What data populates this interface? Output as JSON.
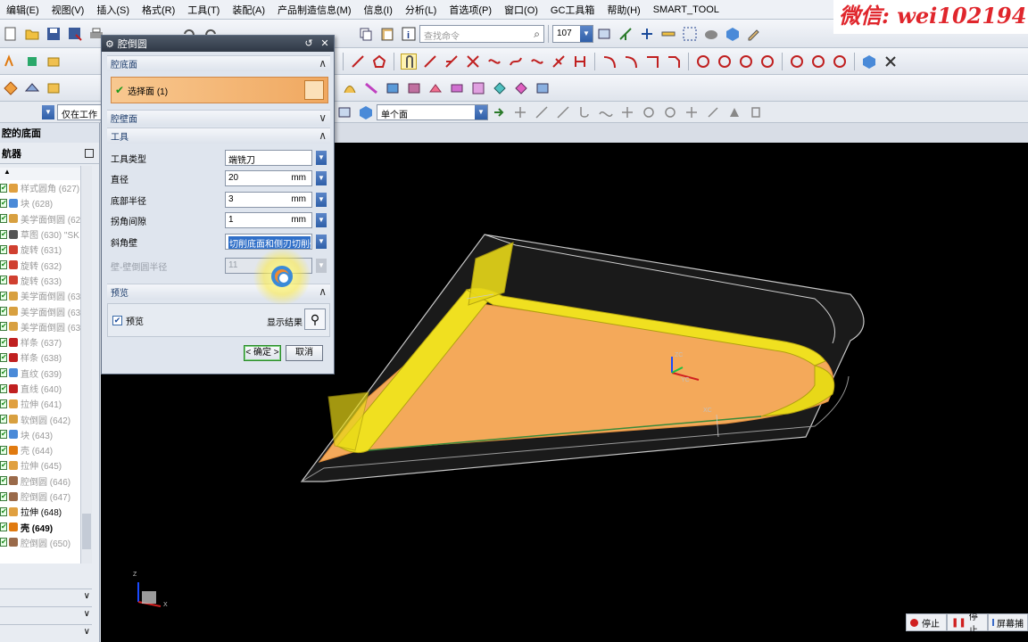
{
  "menu": [
    "编辑(E)",
    "视图(V)",
    "插入(S)",
    "格式(R)",
    "工具(T)",
    "装配(A)",
    "产品制造信息(M)",
    "信息(I)",
    "分析(L)",
    "首选项(P)",
    "窗口(O)",
    "GC工具箱",
    "帮助(H)",
    "SMART_TOOL"
  ],
  "watermark": "微信: wei102194",
  "toolbar": {
    "search_placeholder": "查找命令",
    "zoom_value": "107",
    "scope_value": "仅在工作部",
    "face_filter": "单个面"
  },
  "left_panel": {
    "title": "腔的底面",
    "navigator_title": "航器"
  },
  "tree_items": [
    {
      "label": "样式圆角 (627)",
      "active": false
    },
    {
      "label": "块 (628)",
      "active": false
    },
    {
      "label": "美学面倒圆 (62",
      "active": false
    },
    {
      "label": "草图 (630) \"SK",
      "active": false
    },
    {
      "label": "旋转 (631)",
      "active": false
    },
    {
      "label": "旋转 (632)",
      "active": false
    },
    {
      "label": "旋转 (633)",
      "active": false
    },
    {
      "label": "美学面倒圆 (63",
      "active": false
    },
    {
      "label": "美学面倒圆 (63",
      "active": false
    },
    {
      "label": "美学面倒圆 (63",
      "active": false
    },
    {
      "label": "样条 (637)",
      "active": false
    },
    {
      "label": "样条 (638)",
      "active": false
    },
    {
      "label": "直纹 (639)",
      "active": false
    },
    {
      "label": "直线 (640)",
      "active": false
    },
    {
      "label": "拉伸 (641)",
      "active": false
    },
    {
      "label": "软倒圆 (642)",
      "active": false
    },
    {
      "label": "块 (643)",
      "active": false
    },
    {
      "label": "壳 (644)",
      "active": false
    },
    {
      "label": "拉伸 (645)",
      "active": false
    },
    {
      "label": "腔倒圆 (646)",
      "active": false
    },
    {
      "label": "腔倒圆 (647)",
      "active": false
    },
    {
      "label": "拉伸 (648)",
      "active": true
    },
    {
      "label": "壳 (649)",
      "active": true,
      "bold": true
    },
    {
      "label": "腔倒圆 (650)",
      "active": false
    }
  ],
  "dialog": {
    "title": "腔倒圆",
    "section_floor": "腔底面",
    "select_face": "选择面 (1)",
    "section_wall": "腔壁面",
    "section_tool": "工具",
    "fields": [
      {
        "label": "工具类型",
        "value": "端铣刀",
        "unit": "",
        "kind": "select"
      },
      {
        "label": "直径",
        "value": "20",
        "unit": "mm",
        "kind": "spin"
      },
      {
        "label": "底部半径",
        "value": "3",
        "unit": "mm",
        "kind": "spin"
      },
      {
        "label": "拐角间隙",
        "value": "1",
        "unit": "mm",
        "kind": "spin"
      },
      {
        "label": "斜角壁",
        "value": "切削底面和侧刃切削壁",
        "unit": "",
        "kind": "select-highlight"
      },
      {
        "label": "壁-壁倒圆半径",
        "value": "11",
        "unit": "",
        "kind": "disabled"
      }
    ],
    "section_preview": "预览",
    "preview_label": "预览",
    "show_result": "显示结果",
    "ok": "< 确定 >",
    "cancel": "取消"
  },
  "axes": {
    "z": "ZC",
    "y": "YC",
    "x": "XC",
    "tri_z": "Z",
    "tri_x": "X"
  },
  "status": {
    "stop1": "停止",
    "stop2": "停止",
    "screen": "屏幕捕"
  }
}
